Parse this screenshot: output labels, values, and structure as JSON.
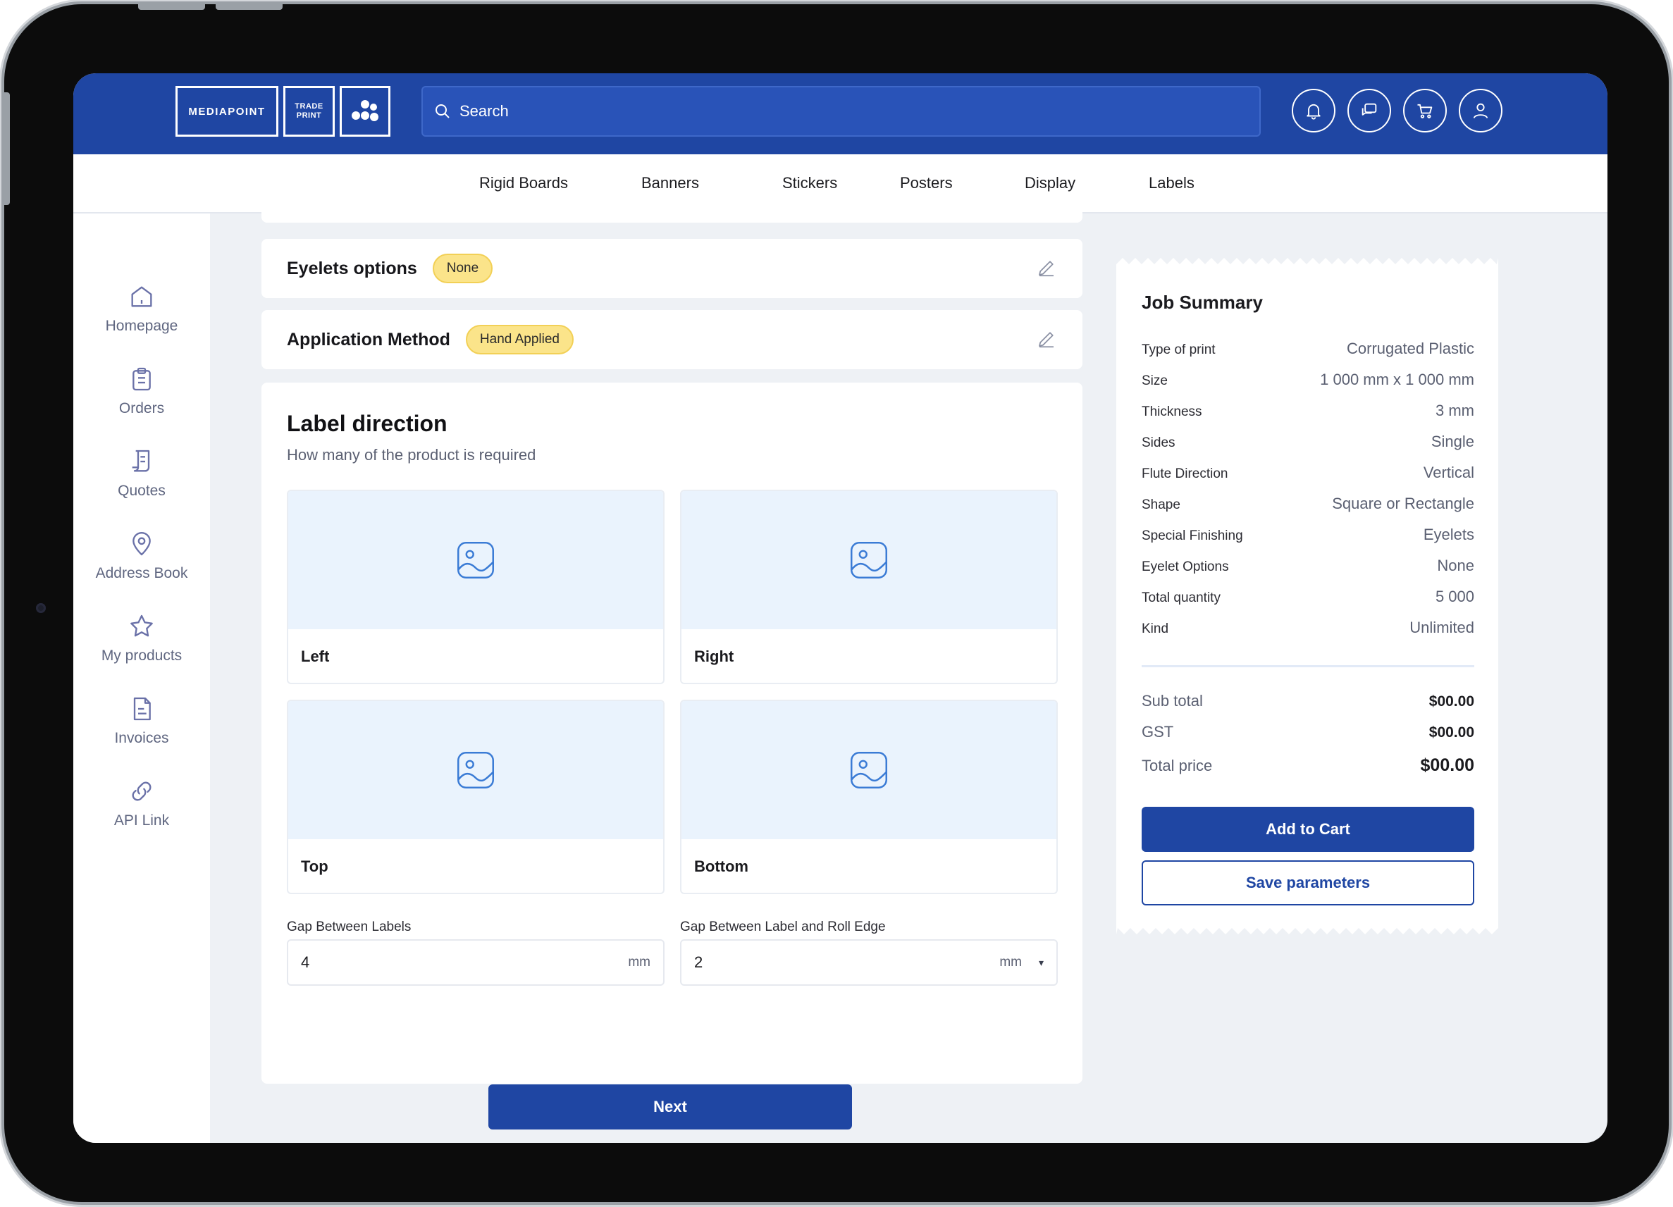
{
  "header": {
    "logo_main": "MEDIAPOINT",
    "logo_trade_line1": "TRADE",
    "logo_trade_line2": "PRINT",
    "search_placeholder": "Search",
    "icons": [
      "bell-icon",
      "chat-icon",
      "cart-icon",
      "user-icon"
    ]
  },
  "nav": {
    "items": [
      "Rigid Boards",
      "Banners",
      "Stickers",
      "Posters",
      "Display",
      "Labels"
    ]
  },
  "sidebar": {
    "items": [
      {
        "label": "Homepage",
        "icon": "home-icon"
      },
      {
        "label": "Orders",
        "icon": "clipboard-icon"
      },
      {
        "label": "Quotes",
        "icon": "document-icon"
      },
      {
        "label": "Address Book",
        "icon": "location-pin-icon"
      },
      {
        "label": "My products",
        "icon": "star-icon"
      },
      {
        "label": "Invoices",
        "icon": "invoice-icon"
      },
      {
        "label": "API Link",
        "icon": "link-icon"
      }
    ]
  },
  "options": {
    "eyelets": {
      "title": "Eyelets options",
      "value": "None"
    },
    "application": {
      "title": "Application Method",
      "value": "Hand Applied"
    }
  },
  "label_direction": {
    "title": "Label direction",
    "subtitle": "How many of the product is required",
    "choices": [
      "Left",
      "Right",
      "Top",
      "Bottom"
    ],
    "gap_labels": {
      "label": "Gap Between Labels",
      "value": "4",
      "unit": "mm"
    },
    "gap_edge": {
      "label": "Gap Between Label and Roll Edge",
      "value": "2",
      "unit": "mm"
    },
    "next": "Next"
  },
  "summary": {
    "title": "Job Summary",
    "rows": [
      {
        "k": "Type of print",
        "v": "Corrugated Plastic"
      },
      {
        "k": "Size",
        "v": "1 000 mm x 1 000 mm"
      },
      {
        "k": "Thickness",
        "v": "3 mm"
      },
      {
        "k": "Sides",
        "v": "Single"
      },
      {
        "k": "Flute Direction",
        "v": "Vertical"
      },
      {
        "k": "Shape",
        "v": "Square or Rectangle"
      },
      {
        "k": "Special Finishing",
        "v": "Eyelets"
      },
      {
        "k": "Eyelet Options",
        "v": "None"
      },
      {
        "k": "Total quantity",
        "v": "5 000"
      },
      {
        "k": "Kind",
        "v": "Unlimited"
      }
    ],
    "subtotal": {
      "k": "Sub total",
      "v": "$00.00"
    },
    "gst": {
      "k": "GST",
      "v": "$00.00"
    },
    "total": {
      "k": "Total price",
      "v": "$00.00"
    },
    "add_to_cart": "Add to Cart",
    "save_parameters": "Save parameters"
  },
  "colors": {
    "brand_blue": "#1f46a3",
    "pill_yellow": "#fbe48a",
    "background": "#eef1f5",
    "image_placeholder": "#eaf3fd"
  }
}
